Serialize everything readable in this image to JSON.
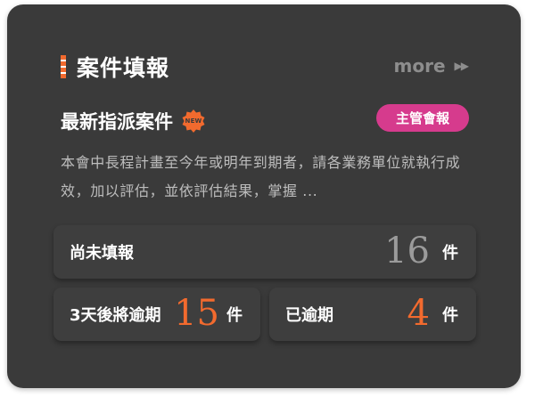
{
  "header": {
    "title": "案件填報",
    "more_label": "more",
    "more_icon": "double-chevron-right-icon"
  },
  "section": {
    "title": "最新指派案件",
    "new_badge": "NEW",
    "tag": "主管會報",
    "description": "本會中長程計畫至今年或明年到期者，請各業務單位就執行成效，加以評估，並依評估結果，掌握 ..."
  },
  "stats": {
    "unfilled": {
      "label": "尚未填報",
      "value": "16",
      "unit": "件"
    },
    "due_soon": {
      "label": "3天後將逾期",
      "value": "15",
      "unit": "件"
    },
    "overdue": {
      "label": "已逾期",
      "value": "4",
      "unit": "件"
    }
  },
  "colors": {
    "card_bg": "#3a3a3a",
    "accent": "#f26a2e",
    "tag_bg": "#d63b8d",
    "number_neutral": "#9b9b9b",
    "number_alert": "#f26a2e"
  }
}
